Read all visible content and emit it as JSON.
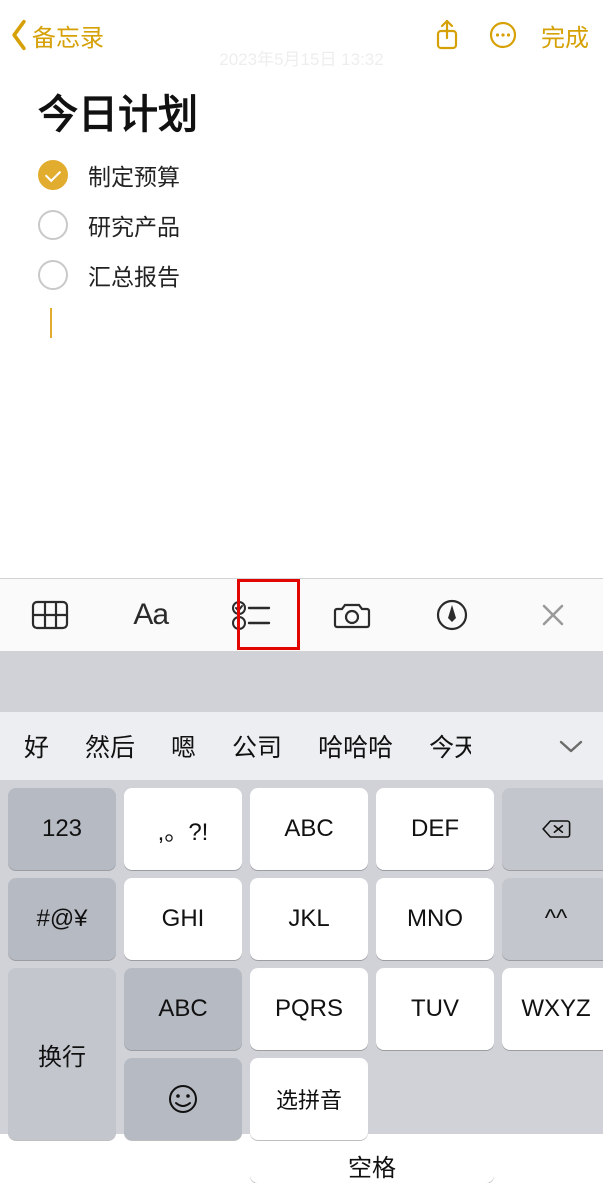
{
  "nav": {
    "back_label": "备忘录",
    "done_label": "完成",
    "timestamp": "2023年5月15日 13:32"
  },
  "note": {
    "title": "今日计划",
    "items": [
      {
        "label": "制定预算",
        "checked": true
      },
      {
        "label": "研究产品",
        "checked": false
      },
      {
        "label": "汇总报告",
        "checked": false
      }
    ]
  },
  "format_toolbar": {
    "aa_label": "Aa"
  },
  "suggestions": [
    "好",
    "然后",
    "嗯",
    "公司",
    "哈哈哈",
    "今天"
  ],
  "keyboard": {
    "num": "123",
    "punct": ",。?!",
    "abc": "ABC",
    "def": "DEF",
    "sym": "#@¥",
    "ghi": "GHI",
    "jkl": "JKL",
    "mno": "MNO",
    "face": "^^",
    "abc2": "ABC",
    "pqrs": "PQRS",
    "tuv": "TUV",
    "wxyz": "WXYZ",
    "return": "换行",
    "pinyin": "选拼音",
    "space": "空格"
  }
}
